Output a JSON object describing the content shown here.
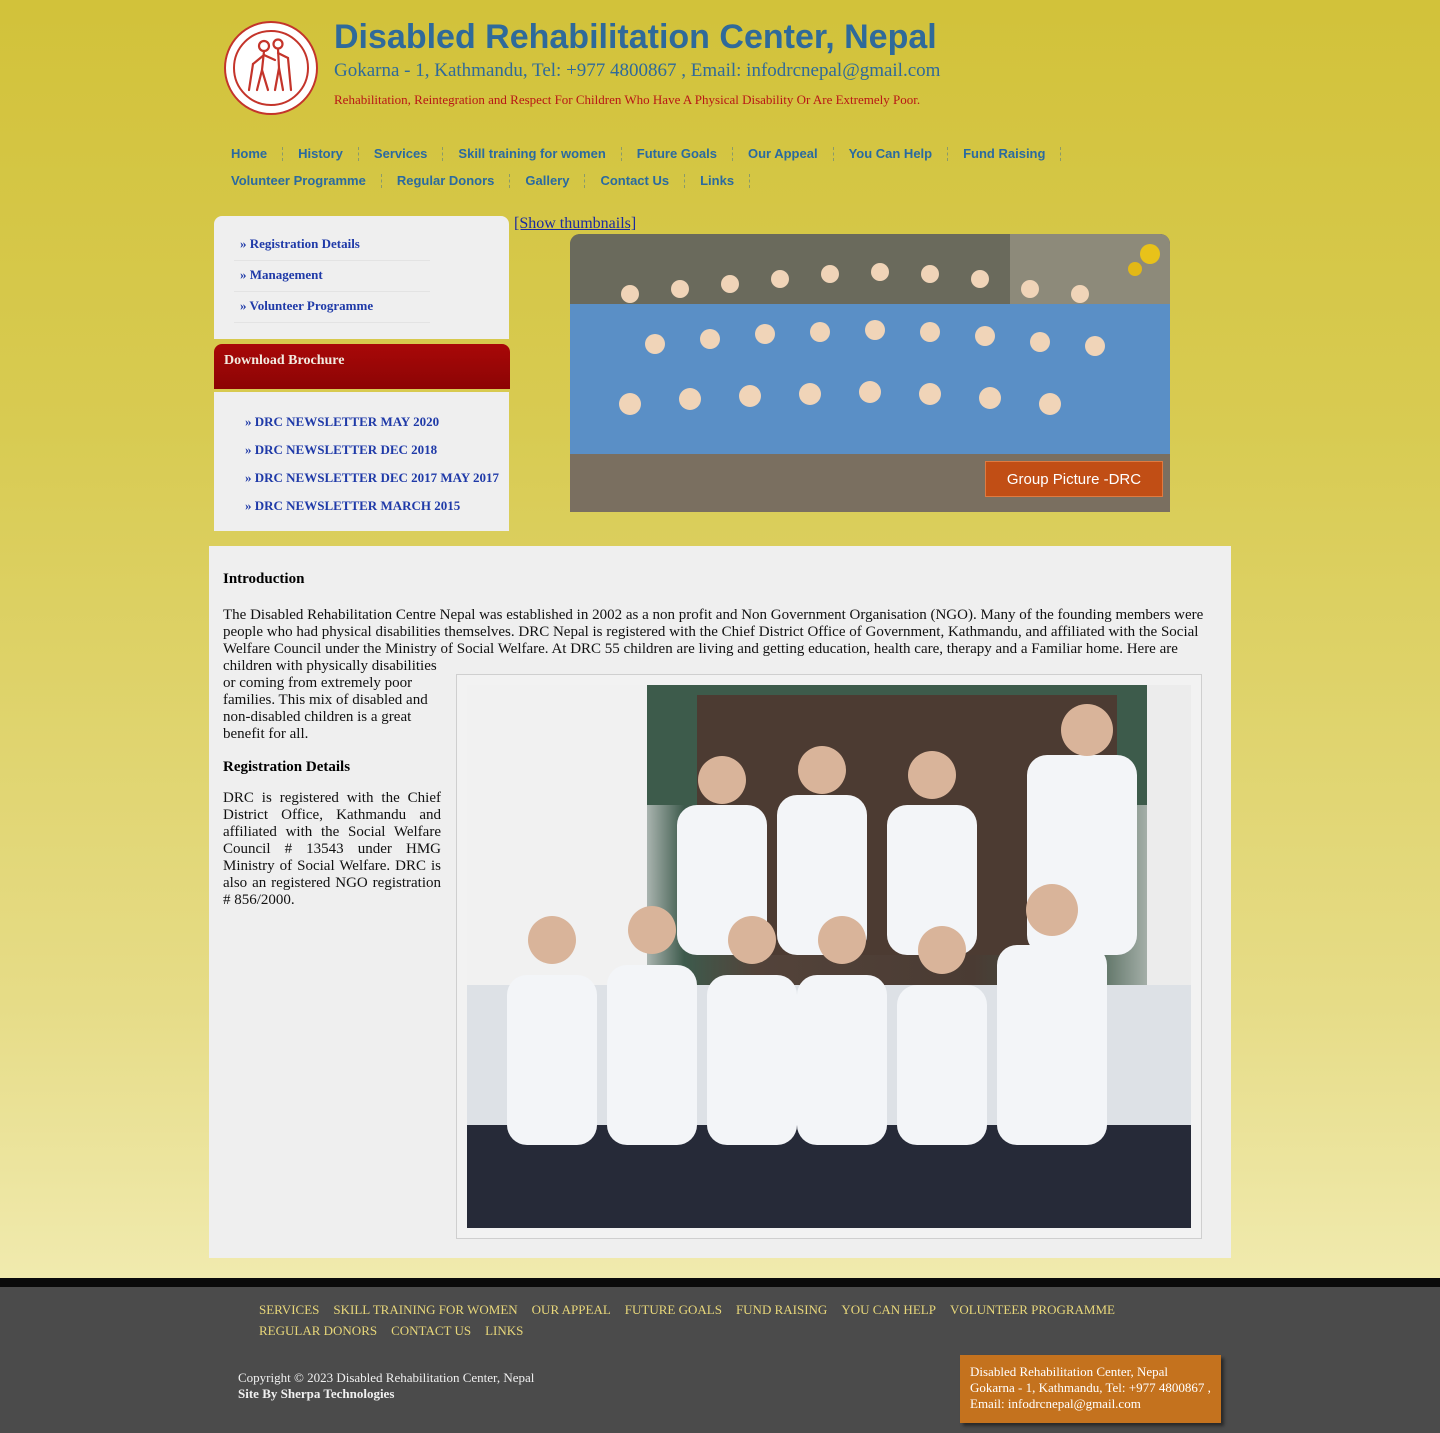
{
  "header": {
    "title": "Disabled Rehabilitation Center, Nepal",
    "contact": "Gokarna - 1, Kathmandu, Tel: +977 4800867 , Email: infodrcnepal@gmail.com",
    "tagline": "Rehabilitation, Reintegration and Respect For Children Who Have A Physical Disability Or Are Extremely Poor."
  },
  "nav": {
    "row1": [
      "Home",
      "History",
      "Services",
      "Skill training for women",
      "Future Goals",
      "Our Appeal",
      "You Can Help",
      "Fund Raising"
    ],
    "row2": [
      "Volunteer Programme",
      "Regular Donors",
      "Gallery",
      "Contact Us",
      "Links"
    ]
  },
  "sidebar": {
    "links": [
      "» Registration Details",
      "» Management",
      "» Volunteer Programme"
    ],
    "brochure_title": "Download Brochure",
    "brochures": [
      "» DRC NEWSLETTER MAY 2020",
      "» DRC NEWSLETTER DEC 2018",
      "» DRC NEWSLETTER DEC 2017 MAY 2017",
      "» DRC NEWSLETTER MARCH 2015"
    ]
  },
  "slideshow": {
    "show_thumbnails": "[Show thumbnails]",
    "caption": "Group Picture -DRC"
  },
  "content": {
    "intro_heading": "Introduction",
    "intro_text_wide": "The Disabled Rehabilitation Centre Nepal was established in 2002 as a non profit and Non Government Organisation (NGO). Many of the founding members were people who had physical disabilities themselves. DRC Nepal is registered with the Chief District Office of Government, Kathmandu, and affiliated with the Social Welfare Council under the Ministry of Social Welfare. At DRC 55 children are living and getting education, health care, therapy and a Familiar home. Here are",
    "intro_text_narrow": "children with physically disabilities or coming from extremely poor families. This mix of disabled and non-disabled children is a great benefit for all.",
    "reg_heading": "Registration Details",
    "reg_text": "DRC is registered with the Chief District Office, Kathmandu and affiliated with the Social Welfare Council # 13543 under HMG Ministry of Social Welfare. DRC is also an registered NGO registration # 856/2000."
  },
  "footer": {
    "nav_row1": [
      "SERVICES",
      "SKILL TRAINING FOR WOMEN",
      "OUR APPEAL",
      "FUTURE GOALS",
      "FUND RAISING",
      "YOU CAN HELP",
      "VOLUNTEER PROGRAMME"
    ],
    "nav_row2": [
      "REGULAR DONORS",
      "CONTACT US",
      "LINKS"
    ],
    "copyright": "Copyright © 2023 Disabled Rehabilitation Center, Nepal",
    "credit": "Site By Sherpa Technologies",
    "contact_name": "Disabled Rehabilitation Center, Nepal",
    "contact_line": "Gokarna - 1, Kathmandu, Tel: +977 4800867 ,",
    "contact_email": "Email: infodrcnepal@gmail.com"
  },
  "colors": {
    "title_blue": "#2f6a9a",
    "tagline_red": "#b81616",
    "brochure_red": "#9a0606",
    "footer_link": "#e8d77a",
    "caption_orange": "#c14e15"
  }
}
